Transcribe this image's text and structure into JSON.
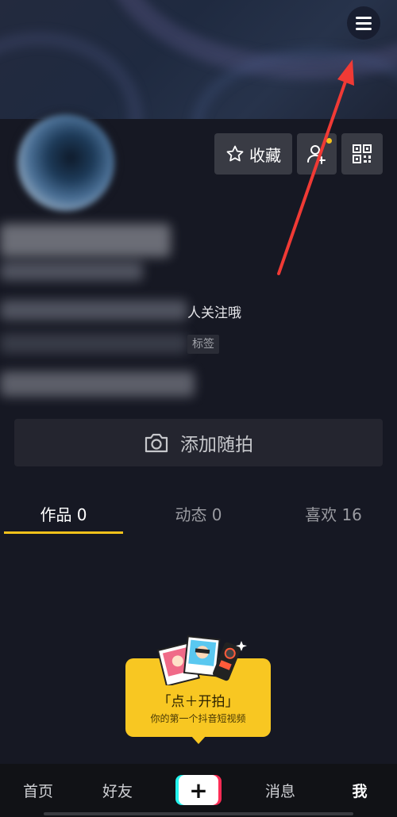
{
  "header": {
    "menu_icon": "hamburger-menu-icon"
  },
  "profile": {
    "favorites_label": "收藏",
    "favorites_icon": "star-icon",
    "add_friend_icon": "add-friend-icon",
    "qr_icon": "qr-code-icon",
    "bio_visible_text": "人关注哦",
    "tag_visible_text": "标签"
  },
  "add_snapshot": {
    "label": "添加随拍",
    "icon": "camera-icon"
  },
  "tabs": [
    {
      "label": "作品 0",
      "active": true
    },
    {
      "label": "动态 0",
      "active": false
    },
    {
      "label": "喜欢 16",
      "active": false
    }
  ],
  "promo": {
    "title": "「点＋开拍」",
    "subtitle": "你的第一个抖音短视频"
  },
  "bottom_nav": {
    "home": "首页",
    "friends": "好友",
    "create": "+",
    "messages": "消息",
    "me": "我"
  },
  "colors": {
    "background": "#161823",
    "accent_yellow": "#f5c21b",
    "annotation_red": "#f03a35",
    "brand_cyan": "#25f4ee",
    "brand_red": "#fe2c55"
  }
}
